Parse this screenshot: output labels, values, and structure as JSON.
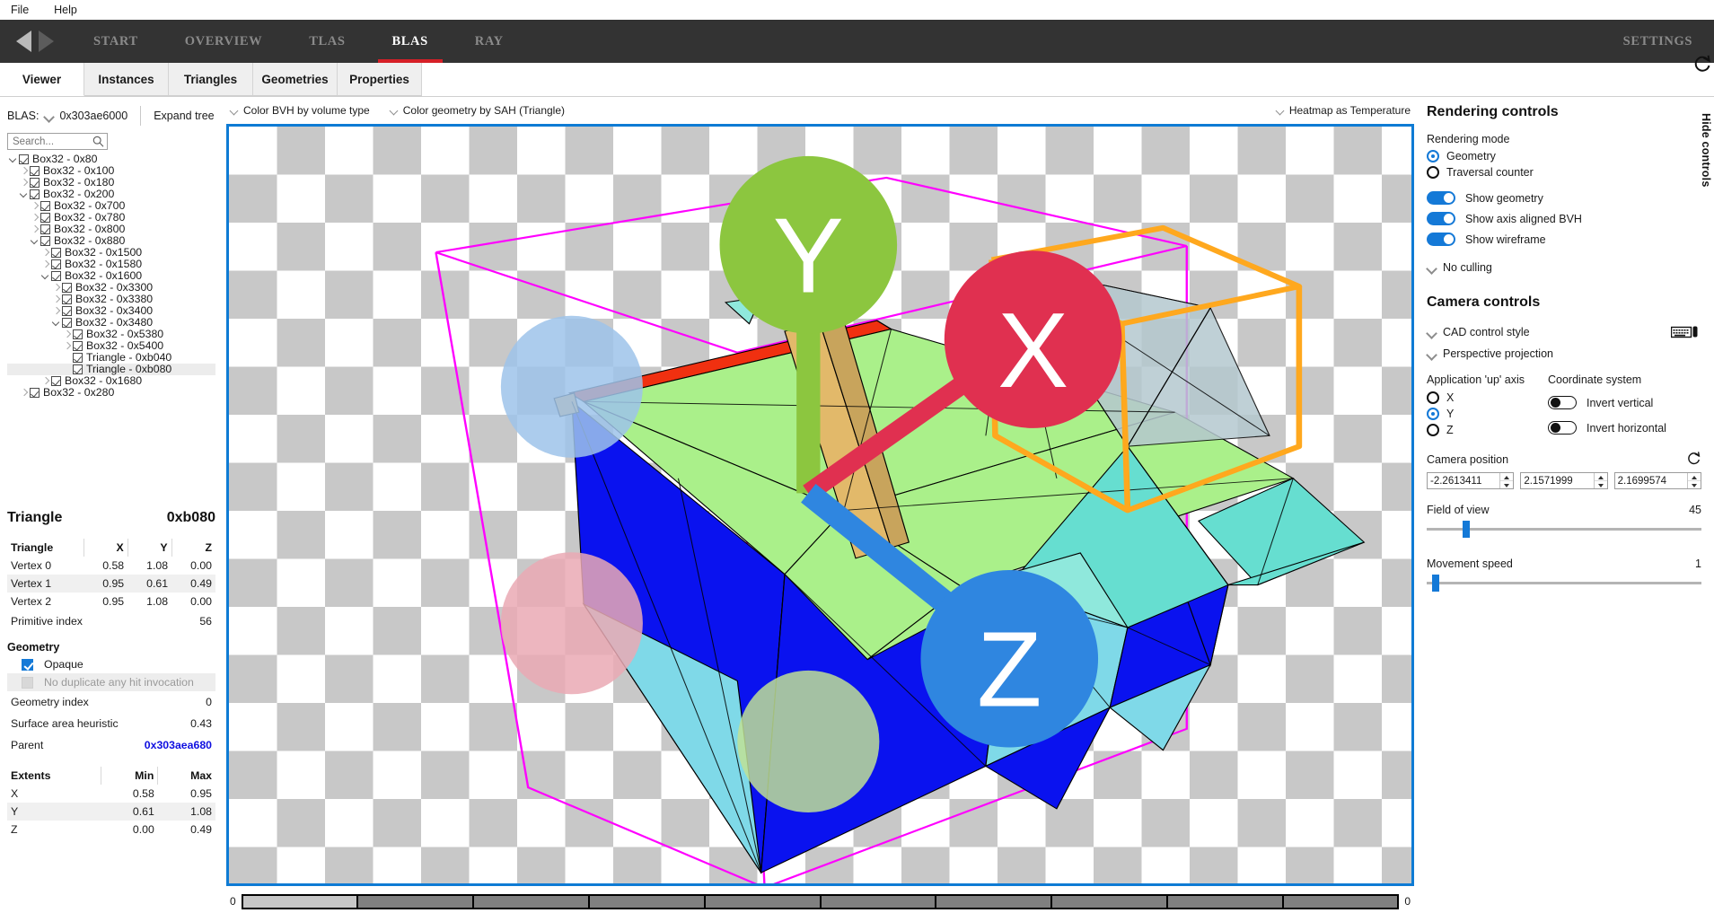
{
  "menubar": {
    "items": [
      "File",
      "Help"
    ]
  },
  "nav": {
    "back_icon": "triangle-left-icon",
    "forward_icon": "triangle-right-icon",
    "tabs": [
      {
        "label": "START",
        "active": false
      },
      {
        "label": "OVERVIEW",
        "active": false
      },
      {
        "label": "TLAS",
        "active": false
      },
      {
        "label": "BLAS",
        "active": true
      },
      {
        "label": "RAY",
        "active": false
      }
    ],
    "settings_label": "SETTINGS",
    "accent_color": "#d62027"
  },
  "subtabs": [
    {
      "label": "Viewer",
      "active": true
    },
    {
      "label": "Instances",
      "active": false
    },
    {
      "label": "Triangles",
      "active": false
    },
    {
      "label": "Geometries",
      "active": false
    },
    {
      "label": "Properties",
      "active": false
    }
  ],
  "left": {
    "blas_label": "BLAS:",
    "blas_address": "0x303ae6000",
    "expand_tree_label": "Expand tree",
    "search_placeholder": "Search...",
    "search_value": "",
    "tree": [
      {
        "depth": 0,
        "twist": "open",
        "checked": true,
        "label": "Box32 - 0x80",
        "selected": false
      },
      {
        "depth": 1,
        "twist": "closed",
        "checked": true,
        "label": "Box32 - 0x100",
        "selected": false
      },
      {
        "depth": 1,
        "twist": "closed",
        "checked": true,
        "label": "Box32 - 0x180",
        "selected": false
      },
      {
        "depth": 1,
        "twist": "open",
        "checked": true,
        "label": "Box32 - 0x200",
        "selected": false
      },
      {
        "depth": 2,
        "twist": "closed",
        "checked": true,
        "label": "Box32 - 0x700",
        "selected": false
      },
      {
        "depth": 2,
        "twist": "closed",
        "checked": true,
        "label": "Box32 - 0x780",
        "selected": false
      },
      {
        "depth": 2,
        "twist": "closed",
        "checked": true,
        "label": "Box32 - 0x800",
        "selected": false
      },
      {
        "depth": 2,
        "twist": "open",
        "checked": true,
        "label": "Box32 - 0x880",
        "selected": false
      },
      {
        "depth": 3,
        "twist": "closed",
        "checked": true,
        "label": "Box32 - 0x1500",
        "selected": false
      },
      {
        "depth": 3,
        "twist": "closed",
        "checked": true,
        "label": "Box32 - 0x1580",
        "selected": false
      },
      {
        "depth": 3,
        "twist": "open",
        "checked": true,
        "label": "Box32 - 0x1600",
        "selected": false
      },
      {
        "depth": 4,
        "twist": "closed",
        "checked": true,
        "label": "Box32 - 0x3300",
        "selected": false
      },
      {
        "depth": 4,
        "twist": "closed",
        "checked": true,
        "label": "Box32 - 0x3380",
        "selected": false
      },
      {
        "depth": 4,
        "twist": "closed",
        "checked": true,
        "label": "Box32 - 0x3400",
        "selected": false
      },
      {
        "depth": 4,
        "twist": "open",
        "checked": true,
        "label": "Box32 - 0x3480",
        "selected": false
      },
      {
        "depth": 5,
        "twist": "closed",
        "checked": true,
        "label": "Box32 - 0x5380",
        "selected": false
      },
      {
        "depth": 5,
        "twist": "closed",
        "checked": true,
        "label": "Box32 - 0x5400",
        "selected": false
      },
      {
        "depth": 5,
        "twist": "none",
        "checked": true,
        "label": "Triangle - 0xb040",
        "selected": false
      },
      {
        "depth": 5,
        "twist": "none",
        "checked": true,
        "label": "Triangle - 0xb080",
        "selected": true
      },
      {
        "depth": 3,
        "twist": "closed",
        "checked": true,
        "label": "Box32 - 0x1680",
        "selected": false
      },
      {
        "depth": 1,
        "twist": "closed",
        "checked": true,
        "label": "Box32 - 0x280",
        "selected": false
      }
    ],
    "detail": {
      "title": "Triangle",
      "address": "0xb080",
      "vertex_table": {
        "headers": [
          "Triangle",
          "X",
          "Y",
          "Z"
        ],
        "rows": [
          [
            "Vertex 0",
            "0.58",
            "1.08",
            "0.00"
          ],
          [
            "Vertex 1",
            "0.95",
            "0.61",
            "0.49"
          ],
          [
            "Vertex 2",
            "0.95",
            "1.08",
            "0.00"
          ]
        ]
      },
      "primitive_index_label": "Primitive index",
      "primitive_index_value": "56",
      "geometry_section_label": "Geometry",
      "opaque_label": "Opaque",
      "opaque_checked": true,
      "no_duplicate_label": "No duplicate any hit invocation",
      "no_duplicate_checked": false,
      "geometry_index_label": "Geometry index",
      "geometry_index_value": "0",
      "sah_label": "Surface area heuristic",
      "sah_value": "0.43",
      "parent_label": "Parent",
      "parent_value": "0x303aea680",
      "parent_color": "#0f0fe0",
      "extents_table": {
        "headers": [
          "Extents",
          "Min",
          "Max"
        ],
        "rows": [
          [
            "X",
            "0.58",
            "0.95"
          ],
          [
            "Y",
            "0.61",
            "1.08"
          ],
          [
            "Z",
            "0.00",
            "0.49"
          ]
        ]
      }
    }
  },
  "viewer_toolbar": {
    "color_bvh": "Color BVH by volume type",
    "color_geometry": "Color geometry by SAH (Triangle)",
    "heatmap": "Heatmap as Temperature"
  },
  "viewport": {
    "border_color": "#0e7bd4",
    "checker_light": "#ffffff",
    "checker_dark": "#c8c8c8",
    "bvh_root_color": "#ff00ff",
    "bvh_selected_color": "#ffa81e",
    "gizmo": {
      "x_label": "X",
      "y_label": "Y",
      "z_label": "Z",
      "x_color": "#e03050",
      "y_color": "#8cc63f",
      "z_color": "#2f86e0"
    }
  },
  "heatmap_footer": {
    "min_label": "0",
    "max_label": "0"
  },
  "right": {
    "rendering_title": "Rendering controls",
    "rendering_mode_label": "Rendering mode",
    "rendering_modes": [
      {
        "label": "Geometry",
        "selected": true
      },
      {
        "label": "Traversal counter",
        "selected": false
      }
    ],
    "toggles": [
      {
        "label": "Show geometry",
        "on": true
      },
      {
        "label": "Show axis aligned BVH",
        "on": true
      },
      {
        "label": "Show wireframe",
        "on": true
      }
    ],
    "culling_label": "No culling",
    "camera_title": "Camera controls",
    "cad_control_label": "CAD control style",
    "projection_label": "Perspective projection",
    "keyboard_icon": "keyboard-mouse-icon",
    "up_axis_label": "Application 'up' axis",
    "up_axes": [
      {
        "label": "X",
        "selected": false
      },
      {
        "label": "Y",
        "selected": true
      },
      {
        "label": "Z",
        "selected": false
      }
    ],
    "coordinate_label": "Coordinate system",
    "coord_toggles": [
      {
        "label": "Invert vertical",
        "on": false
      },
      {
        "label": "Invert horizontal",
        "on": false
      }
    ],
    "camera_position_label": "Camera position",
    "camera_position": [
      "-2.2613411",
      "2.1571999",
      "2.1699574"
    ],
    "reset_icon": "refresh-icon",
    "fov_label": "Field of view",
    "fov_value": "45",
    "fov_percent": 13,
    "speed_label": "Movement speed",
    "speed_value": "1",
    "speed_percent": 2,
    "hide_controls_label": "Hide controls",
    "accent_color": "#1479d7"
  }
}
